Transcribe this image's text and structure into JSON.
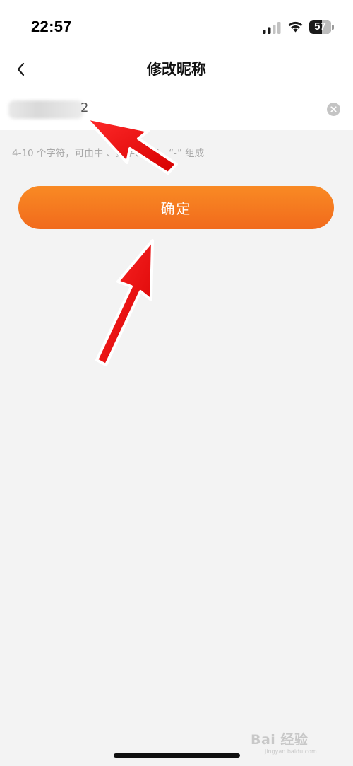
{
  "status_bar": {
    "time": "22:57",
    "battery_level": "57",
    "signal_icon": "signal-bars-icon",
    "wifi_icon": "wifi-icon",
    "battery_icon": "battery-icon"
  },
  "nav": {
    "title": "修改昵称",
    "back_icon": "chevron-left-icon"
  },
  "nickname_field": {
    "visible_tail": "2",
    "clear_icon": "clear-circle-icon"
  },
  "hint": "4-10 个字符，可由中     、数字、“_”、“-” 组成",
  "confirm_button": {
    "label": "确定"
  },
  "watermark": {
    "text": "Bai 经验",
    "sub": "jingyan.baidu.com"
  },
  "colors": {
    "accent": "#f47a20",
    "accent_dark": "#f16a1c",
    "page_background": "#f3f3f3",
    "hint_text": "#a8a8a8",
    "annotation_arrow": "#ee0c0c"
  }
}
